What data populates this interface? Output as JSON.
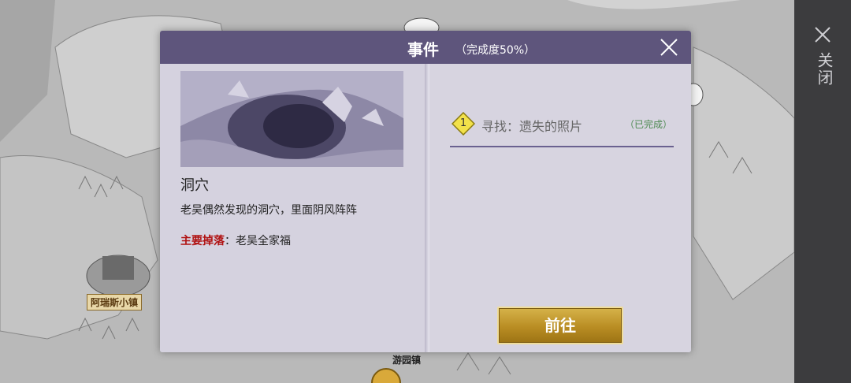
{
  "map": {
    "town_label": "阿瑞斯小镇",
    "park_label": "游园镇"
  },
  "side_panel": {
    "close_label": "关闭"
  },
  "dialog": {
    "title": "事件",
    "progress": "（完成度50%）",
    "event": {
      "name": "洞穴",
      "description": "老吴偶然发现的洞穴，里面阴风阵阵",
      "drop_label": "主要掉落",
      "drop_colon": "：",
      "drop_value": "老吴全家福"
    },
    "tasks": [
      {
        "number": "1",
        "text": "寻找：遗失的照片",
        "status": "（已完成）"
      }
    ],
    "go_button": "前往"
  },
  "colors": {
    "header": "#5e557c",
    "panel": "#d7d4e0",
    "drop_label": "#b01010",
    "task_status": "#4e8a52",
    "button_gold": "#c9a030"
  }
}
